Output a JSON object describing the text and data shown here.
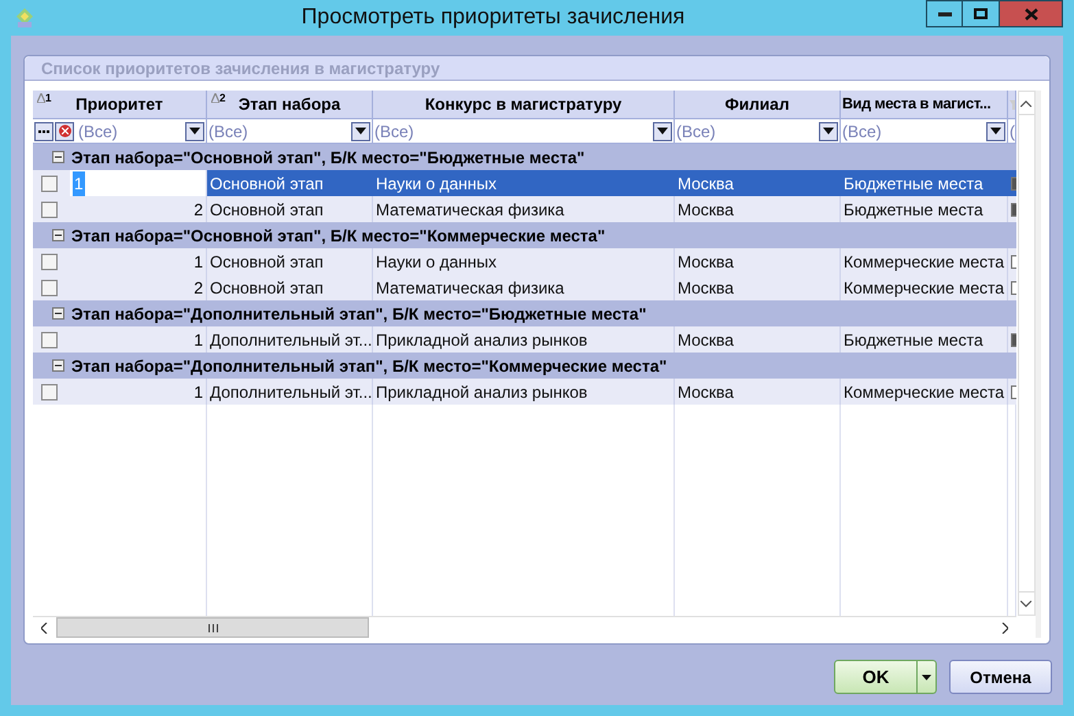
{
  "window": {
    "title": "Просмотреть приоритеты зачисления"
  },
  "panel": {
    "title": "Список приоритетов зачисления в магистратуру"
  },
  "table": {
    "columns": [
      {
        "label": "Приоритет",
        "sort": "1"
      },
      {
        "label": "Этап набора",
        "sort": "2"
      },
      {
        "label": "Конкурс в магистратуру"
      },
      {
        "label": "Филиал"
      },
      {
        "label": "Вид места в магист..."
      },
      {}
    ],
    "filters": [
      "(Все)",
      "(Все)",
      "(Все)",
      "(Все)",
      "(Все)",
      "("
    ],
    "groups": [
      {
        "label": "Этап набора=\"Основной этап\", Б/К место=\"Бюджетные места\"",
        "expanded": true,
        "rows": [
          {
            "checked": false,
            "selected": true,
            "flag": true,
            "cells": [
              "1",
              "Основной этап",
              "Науки о данных",
              "Москва",
              "Бюджетные места"
            ]
          },
          {
            "checked": false,
            "selected": false,
            "flag": true,
            "cells": [
              "2",
              "Основной этап",
              "Математическая физика",
              "Москва",
              "Бюджетные места"
            ]
          }
        ]
      },
      {
        "label": "Этап набора=\"Основной этап\", Б/К место=\"Коммерческие места\"",
        "expanded": true,
        "rows": [
          {
            "checked": false,
            "selected": false,
            "flag": false,
            "cells": [
              "1",
              "Основной этап",
              "Науки о данных",
              "Москва",
              "Коммерческие места"
            ]
          },
          {
            "checked": false,
            "selected": false,
            "flag": false,
            "cells": [
              "2",
              "Основной этап",
              "Математическая физика",
              "Москва",
              "Коммерческие места"
            ]
          }
        ]
      },
      {
        "label": "Этап набора=\"Дополнительный этап\", Б/К место=\"Бюджетные места\"",
        "expanded": true,
        "rows": [
          {
            "checked": false,
            "selected": false,
            "flag": true,
            "cells": [
              "1",
              "Дополнительный эт...",
              "Прикладной анализ рынков",
              "Москва",
              "Бюджетные места"
            ]
          }
        ]
      },
      {
        "label": "Этап набора=\"Дополнительный этап\", Б/К место=\"Коммерческие места\"",
        "expanded": true,
        "rows": [
          {
            "checked": false,
            "selected": false,
            "flag": false,
            "cells": [
              "1",
              "Дополнительный эт...",
              "Прикладной анализ рынков",
              "Москва",
              "Коммерческие места"
            ]
          }
        ]
      }
    ]
  },
  "buttons": [
    {
      "label": "OK",
      "kind": "split"
    },
    {
      "label": "Отмена",
      "kind": "plain"
    }
  ]
}
